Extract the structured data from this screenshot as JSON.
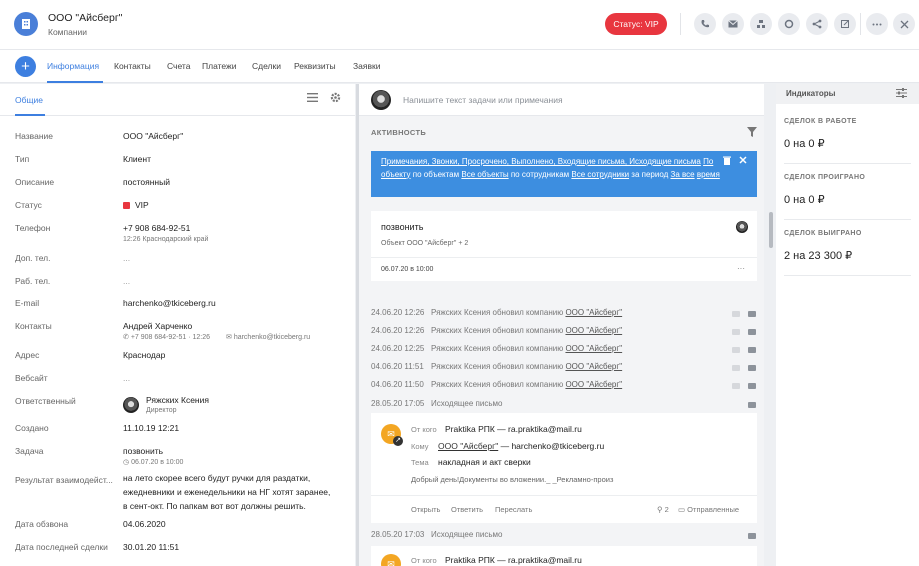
{
  "header": {
    "title": "ООО \"Айсберг\"",
    "subtitle": "Компании",
    "status_label": "Статус: VIP",
    "accent": "#3d7fe0",
    "status_color": "#e8363f",
    "action_icons": [
      "phone-icon",
      "mail-icon",
      "org-icon",
      "circle-icon",
      "share-icon",
      "external-link-icon",
      "more-icon",
      "close-icon"
    ]
  },
  "tabs": [
    {
      "label": "Информация",
      "active": true
    },
    {
      "label": "Контакты"
    },
    {
      "label": "Счета"
    },
    {
      "label": "Платежи"
    },
    {
      "label": "Сделки"
    },
    {
      "label": "Реквизиты"
    },
    {
      "label": "Заявки"
    }
  ],
  "info": {
    "section_title": "Общие",
    "fields": {
      "name": {
        "label": "Название",
        "value": "ООО \"Айсберг\""
      },
      "type": {
        "label": "Тип",
        "value": "Клиент"
      },
      "description": {
        "label": "Описание",
        "value": "постоянный"
      },
      "status": {
        "label": "Статус",
        "value": "VIP"
      },
      "phone": {
        "label": "Телефон",
        "value": "+7 908 684-92-51",
        "sub": "12:26 Краснодарский край"
      },
      "extra_phone": {
        "label": "Доп. тел.",
        "value": "..."
      },
      "work_phone": {
        "label": "Раб. тел.",
        "value": "..."
      },
      "email": {
        "label": "E-mail",
        "value": "harchenko@tkiceberg.ru"
      },
      "contacts": {
        "label": "Контакты",
        "value": "Андрей Харченко",
        "phone": "+7 908 684-92-51 · 12:26",
        "email": "harchenko@tkiceberg.ru"
      },
      "address": {
        "label": "Адрес",
        "value": "Краснодар"
      },
      "website": {
        "label": "Вебсайт",
        "value": "..."
      },
      "responsible": {
        "label": "Ответственный",
        "value": "Ряжских Ксения",
        "role": "Директор"
      },
      "created": {
        "label": "Создано",
        "value": "11.10.19 12:21"
      },
      "task": {
        "label": "Задача",
        "value": "позвонить",
        "sub": "06.07.20 в 10:00"
      },
      "call_result": {
        "label": "Результат взаимодейст...",
        "lines": [
          "на лето скорее всего будут ручки для раздатки,",
          "ежедневники и еженедельники на НГ хотят заранее,",
          "в сент-окт. По папкам вот вот должны решить."
        ]
      },
      "call_date": {
        "label": "Дата обзвона",
        "value": "04.06.2020"
      },
      "last_deal": {
        "label": "Дата последней сделки",
        "value": "30.01.20 11:51"
      }
    }
  },
  "activity": {
    "task_placeholder": "Напишите текст задачи или примечания",
    "title": "АКТИВНОСТЬ",
    "filter": {
      "types": "Примечания, Звонки, Просрочено, Выполнено, Входящие письма, Исходящие письма",
      "p1": "По",
      "p2": "объекту",
      "p3": "по объектам",
      "all_objects": "Все объекты",
      "p4": "по сотрудникам",
      "all_employees": "Все сотрудники",
      "p5": "за период",
      "all_time_1": "За все",
      "all_time_2": "время"
    },
    "task_card": {
      "title": "позвонить",
      "object": "Объект  ООО \"Айсберг\" + 2",
      "date": "06.07.20 в 10:00"
    },
    "log": [
      {
        "date": "24.06.20 12:26",
        "text": "Ряжских Ксения обновил компанию",
        "link": "ООО \"Айсберг\""
      },
      {
        "date": "24.06.20 12:26",
        "text": "Ряжских Ксения обновил компанию",
        "link": "ООО \"Айсберг\""
      },
      {
        "date": "24.06.20 12:25",
        "text": "Ряжских Ксения обновил компанию",
        "link": "ООО \"Айсберг\""
      },
      {
        "date": "04.06.20 11:51",
        "text": "Ряжских Ксения обновил компанию",
        "link": "ООО \"Айсберг\""
      },
      {
        "date": "04.06.20 11:50",
        "text": "Ряжских Ксения обновил компанию",
        "link": "ООО \"Айсберг\""
      },
      {
        "date": "28.05.20 17:05",
        "text": "Исходящее письмо",
        "link": ""
      }
    ],
    "mail": {
      "from_label": "От кого",
      "from_value": "Praktika РПК — ra.praktika@mail.ru",
      "to_label": "Кому",
      "to_link": "ООО \"Айсберг\"",
      "to_rest": " — harchenko@tkiceberg.ru",
      "subject_label": "Тема",
      "subject_value": "накладная и акт сверки",
      "preview": "Добрый день!Документы во вложении._ _Рекламно-произ",
      "open": "Открыть",
      "reply": "Ответить",
      "forward": "Переслать",
      "attachments": "2",
      "sent": "Отправленные"
    },
    "log2": {
      "date": "28.05.20 17:03",
      "text": "Исходящее письмо"
    },
    "mail2": {
      "from_label": "От кого",
      "from_value": "Praktika РПК — ra.praktika@mail.ru"
    }
  },
  "indicators": {
    "title": "Индикаторы",
    "items": [
      {
        "label": "СДЕЛОК В РАБОТЕ",
        "value": "0 на 0 ₽"
      },
      {
        "label": "СДЕЛОК ПРОИГРАНО",
        "value": "0 на 0 ₽"
      },
      {
        "label": "СДЕЛОК ВЫИГРАНО",
        "value": "2 на 23 300 ₽"
      }
    ]
  }
}
